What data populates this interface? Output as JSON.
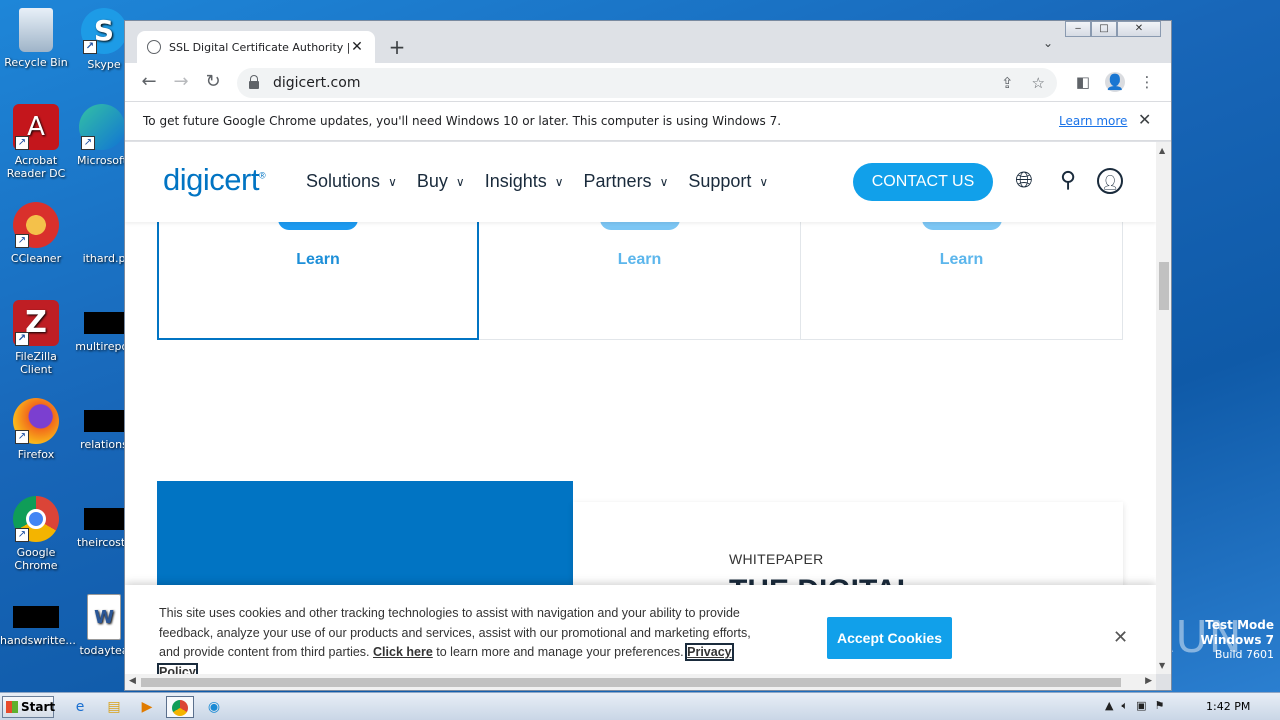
{
  "desktop": {
    "icons": [
      {
        "label": "Recycle Bin",
        "name": "recycle-bin"
      },
      {
        "label": "Skype",
        "name": "skype"
      },
      {
        "label": "Acrobat Reader DC",
        "name": "acrobat-reader"
      },
      {
        "label": "Microsoft",
        "name": "microsoft-edge"
      },
      {
        "label": "CCleaner",
        "name": "ccleaner"
      },
      {
        "label": "ithard.p",
        "name": "ithard-file"
      },
      {
        "label": "FileZilla Client",
        "name": "filezilla"
      },
      {
        "label": "multirepor",
        "name": "multirepor-file"
      },
      {
        "label": "Firefox",
        "name": "firefox"
      },
      {
        "label": "relations",
        "name": "relations-file"
      },
      {
        "label": "Google Chrome",
        "name": "google-chrome"
      },
      {
        "label": "theircosts",
        "name": "theircosts-file"
      },
      {
        "label": "handswritte...",
        "name": "handswritte-file"
      },
      {
        "label": "todaytea",
        "name": "todaytea-file"
      }
    ],
    "watermark": {
      "line1": "Test Mode",
      "line2": "Windows 7",
      "line3": "Build 7601"
    },
    "anyrun": "ANY RUN"
  },
  "browser": {
    "tab_title": "SSL Digital Certificate Authority | En",
    "url": "digicert.com",
    "infobar": {
      "message": "To get future Google Chrome updates, you'll need Windows 10 or later. This computer is using Windows 7.",
      "learn_more": "Learn more"
    }
  },
  "site": {
    "logo": "digicert",
    "nav": [
      "Solutions",
      "Buy",
      "Insights",
      "Partners",
      "Support"
    ],
    "contact": "CONTACT US",
    "cards": [
      {
        "learn": "Learn"
      },
      {
        "learn": "Learn"
      },
      {
        "learn": "Learn"
      }
    ],
    "whitepaper": {
      "label": "WHITEPAPER",
      "title": "THE DIGITAL"
    }
  },
  "cookie": {
    "text1": "This site uses cookies and other tracking technologies to assist with navigation and your ability to provide feedback, analyze your use of our products and services, assist with our promotional and marketing efforts, and provide content from third parties.",
    "click_here": "Click here",
    "text2": "to learn more and manage your preferences.",
    "privacy": "Privacy Policy",
    "accept": "Accept Cookies"
  },
  "taskbar": {
    "start": "Start",
    "clock": "1:42 PM"
  }
}
